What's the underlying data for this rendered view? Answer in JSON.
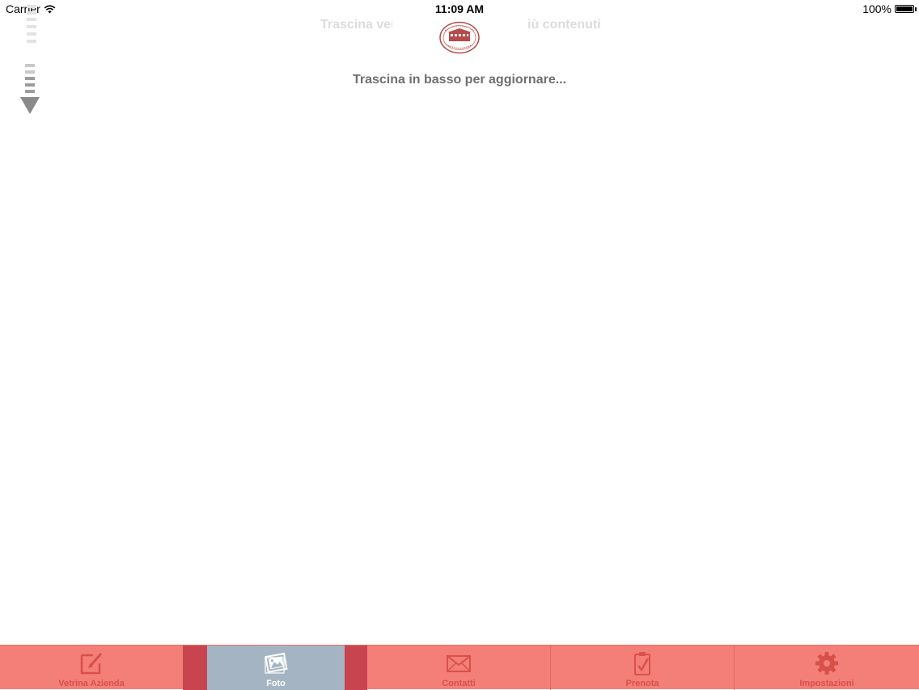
{
  "status_bar": {
    "carrier": "Carrier",
    "time": "11:09 AM",
    "battery": "100%"
  },
  "pull_to_refresh": {
    "background_text_left": "Trascina ver",
    "background_text_right": "iù contenuti",
    "message": "Trascina in basso per aggiornare...",
    "icon": "arrow-down-icon"
  },
  "tab_bar": {
    "tabs": [
      {
        "label": "Vetrina Azienda",
        "icon": "edit-icon"
      },
      {
        "label": "Foto",
        "icon": "photo-icon",
        "selected": true
      },
      {
        "label": "Contatti",
        "icon": "mail-icon"
      },
      {
        "label": "Prenota",
        "icon": "clipboard-check-icon"
      },
      {
        "label": "Impostazioni",
        "icon": "gear-icon"
      }
    ]
  },
  "colors": {
    "tab_bar": "#f47f78",
    "tab_icon": "#d8504a",
    "tab_selected": "#a5b4c2",
    "tab_selected_frame": "#c8454f",
    "message_text": "#6f6f6f"
  }
}
